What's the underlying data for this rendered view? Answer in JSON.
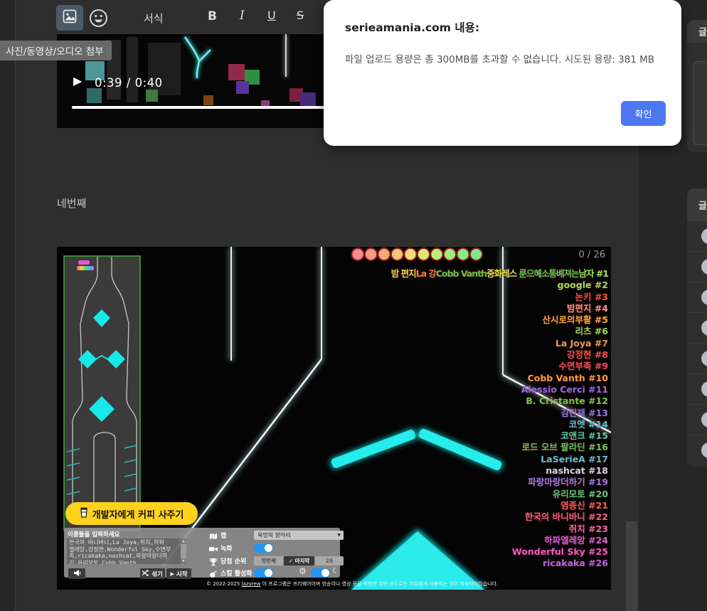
{
  "toolbar": {
    "tooltip": "사진/동영상/오디오 첨부",
    "format_label": "서식",
    "bold_label": "B",
    "italic_label": "I",
    "underline_label": "U",
    "strike_label": "S"
  },
  "dialog": {
    "title": "serieamania.com 내용:",
    "message": "파일 업로드 용량은 총 300MB를 초과할 수 없습니다. 시도된 용량: 381 MB",
    "confirm_label": "확인",
    "accent_color": "#4d78f2"
  },
  "video": {
    "time": "0:39 / 0:40",
    "play_icon": "▶",
    "progress_pct": 97.5
  },
  "editor": {
    "paragraph": "네번째"
  },
  "sidebar": {
    "panel1_header": "글",
    "panel2_header": "글",
    "row_count": 8
  },
  "game": {
    "counter": "0 / 26",
    "progress_circles": [
      "#f28c8c",
      "#f29c80",
      "#f2ac74",
      "#f2c478",
      "#eedd7c",
      "#d8e878",
      "#bcec7c",
      "#9eec80",
      "#88ec84",
      "#7cec8a"
    ],
    "circle_ring_color": "#8a1a1a",
    "rank1_segments": [
      {
        "text": "밤 편지",
        "color": "#e8d44a"
      },
      {
        "text": "La 강",
        "color": "#e8823a"
      },
      {
        "text": "Cobb Vanth",
        "color": "#6cc04c"
      },
      {
        "text": "중화레스",
        "color": "#d8e24e"
      },
      {
        "text": " 룬으혜소통볘져는",
        "color": "#58c858"
      },
      {
        "text": "남자 #1",
        "color": "#8ae858"
      }
    ],
    "rankings": [
      {
        "name": "google",
        "rank": 2,
        "color": "#9ce05c"
      },
      {
        "name": "논키",
        "rank": 3,
        "color": "#e8503c"
      },
      {
        "name": "밤편지",
        "rank": 4,
        "color": "#f09488"
      },
      {
        "name": "산시로의부활",
        "rank": 5,
        "color": "#eca83c"
      },
      {
        "name": "리츠",
        "rank": 6,
        "color": "#8cdc5c"
      },
      {
        "name": "La Joya",
        "rank": 7,
        "color": "#d89c5c"
      },
      {
        "name": "강정현",
        "rank": 8,
        "color": "#e8544c"
      },
      {
        "name": "수면부족",
        "rank": 9,
        "color": "#e84c5c"
      },
      {
        "name": "Cobb Vanth",
        "rank": 10,
        "color": "#f09c3c"
      },
      {
        "name": "Alessio Cerci",
        "rank": 11,
        "color": "#8a6ce8"
      },
      {
        "name": "B. Cristante",
        "rank": 12,
        "color": "#6cc84c"
      },
      {
        "name": "김민재",
        "rank": 13,
        "color": "#7c7cec"
      },
      {
        "name": "코엣",
        "rank": 14,
        "color": "#4cc8e0"
      },
      {
        "name": "코앤크",
        "rank": 15,
        "color": "#4cc8a4"
      },
      {
        "name": "로드 오브 팔라딘",
        "rank": 16,
        "color": "#5cc85c"
      },
      {
        "name": "LaSerieA",
        "rank": 17,
        "color": "#54bcd4"
      },
      {
        "name": "nashcat",
        "rank": 18,
        "color": "#c4d8e8"
      },
      {
        "name": "파랑마랑더하기",
        "rank": 19,
        "color": "#907ce8"
      },
      {
        "name": "유리모토",
        "rank": 20,
        "color": "#54c87c"
      },
      {
        "name": "염종신",
        "rank": 21,
        "color": "#e85c5c"
      },
      {
        "name": "한국의 바니바니",
        "rank": 22,
        "color": "#e8647c"
      },
      {
        "name": "쥐치",
        "rank": 23,
        "color": "#e864a4"
      },
      {
        "name": "하파엘레앙",
        "rank": 24,
        "color": "#c464d8"
      },
      {
        "name": "Wonderful Sky",
        "rank": 25,
        "color": "#e85cc8"
      },
      {
        "name": "ricakaka",
        "rank": 26,
        "color": "#a86ce0"
      }
    ],
    "coffee_button": "개발자에게 커피 사주기",
    "names_label": "이름들을 입력하세요",
    "names_lines": [
      "한국의 바니바니,La Joya,쥐치,하파",
      "엘레앙,강정현,Wonderful Sky,수면부",
      "족,ricakaka,nashcat,파랑마랑더하",
      {
        "pre": "기,유리모토,Cobb ",
        "misspelled": "Vanth"
      }
    ],
    "shuffle_label": "섞기",
    "start_label": "시작",
    "start_icon": "▶",
    "settings": {
      "map_label": "맵",
      "map_value": "욕망의 항아리",
      "record_label": "녹화",
      "prize_label": "당첨 순위",
      "seg_first": "첫번째",
      "seg_last": "✓ 마지막",
      "seg_count": "26",
      "skill_label": "스킬 활성화",
      "toggle_on_color": "#2196f3"
    },
    "copyright_prefix": "© 2022-2025 ",
    "copyright_link": "lazyrew",
    "copyright_suffix": " 이 프로그램은 프리웨어이며 방송이나 영상 등을 포함한 어떤 용도로든 자유롭게 사용하는 것이 허용되어있습니다."
  }
}
